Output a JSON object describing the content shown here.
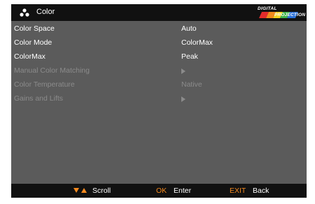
{
  "header": {
    "title": "Color",
    "icon": "color-dots-icon",
    "logo": {
      "line1": "DIGITAL",
      "line2": "PROJECTION"
    }
  },
  "menu": {
    "items": [
      {
        "label": "Color Space",
        "value": "Auto",
        "enabled": true
      },
      {
        "label": "Color Mode",
        "value": "ColorMax",
        "enabled": true
      },
      {
        "label": "ColorMax",
        "value": "Peak",
        "enabled": true
      },
      {
        "label": "Manual Color Matching",
        "value": "",
        "submenu_icon": "play-arrow-icon",
        "enabled": false
      },
      {
        "label": "Color Temperature",
        "value": "Native",
        "enabled": false
      },
      {
        "label": "Gains and Lifts",
        "value": "",
        "submenu_icon": "play-arrow-icon",
        "enabled": false
      }
    ]
  },
  "footer": {
    "scroll_icon": "down-up-arrows-icon",
    "scroll_label": "Scroll",
    "ok_key": "OK",
    "ok_label": "Enter",
    "exit_key": "EXIT",
    "exit_label": "Back"
  },
  "colors": {
    "panel_bg": "#5b5b5b",
    "bar_bg": "#111111",
    "text": "#ffffff",
    "disabled_text": "#8b8b8b",
    "accent": "#f58a1f"
  }
}
